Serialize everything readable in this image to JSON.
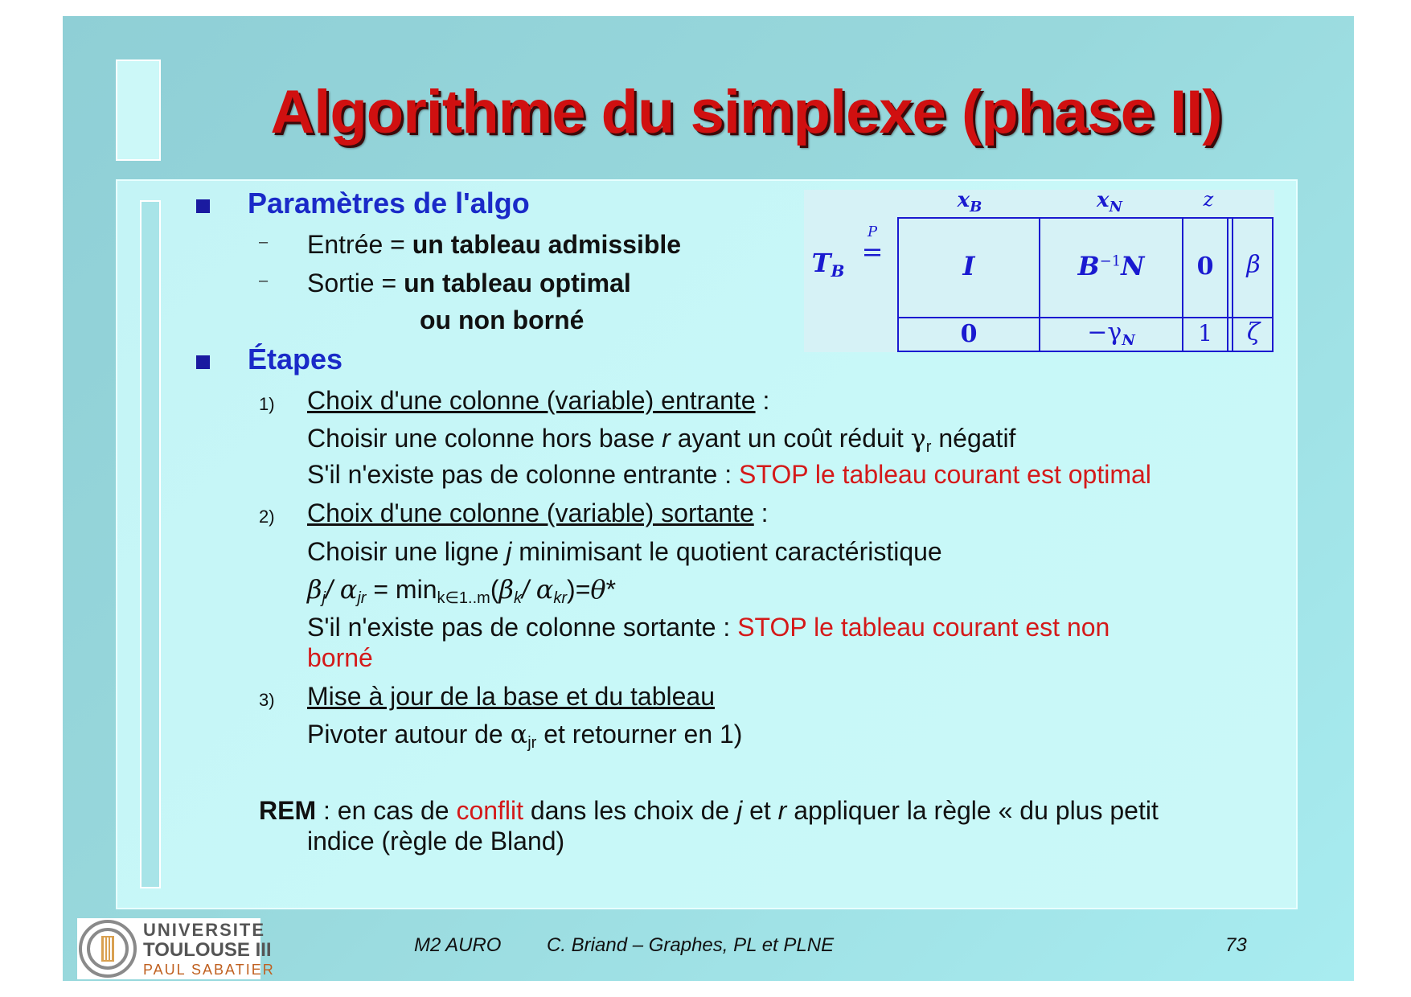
{
  "slide": {
    "title": "Algorithme du simplexe (phase II)",
    "sections": {
      "params_heading": "Paramètres de l'algo",
      "params": [
        {
          "bullet": "–",
          "prefix": "Entrée = ",
          "bold": "un tableau admissible"
        },
        {
          "bullet": "–",
          "prefix": "Sortie = ",
          "bold": "un tableau optimal",
          "bold_line2": "ou non borné"
        }
      ],
      "steps_heading": "Étapes",
      "steps": [
        {
          "num": "1)",
          "title": "Choix d'une colonne (variable) entrante",
          "colon": " :",
          "line1_a": "Choisir une colonne hors base ",
          "line1_var": "r",
          "line1_b": "  ayant un coût réduit ",
          "line1_gamma": "γ",
          "line1_sub": "r",
          "line1_c": " négatif",
          "line2_a": "S'il n'existe pas de colonne entrante : ",
          "line2_red": "STOP le tableau courant est optimal"
        },
        {
          "num": "2)",
          "title": "Choix d'une colonne (variable) sortante",
          "colon": " :",
          "line1_a": "Choisir une ligne ",
          "line1_var": "j",
          "line1_b": " minimisant le quotient caractéristique",
          "formula": {
            "beta": "β",
            "sub_j": "j",
            "slash": "/  ",
            "alpha": "α",
            "sub_jr": "jr",
            "eq_min": " = min",
            "sub_k": "k∈1..m",
            "open": "(",
            "beta_k": "β",
            "sub_k2": "k",
            "slash2": "/  ",
            "alpha_k": "α",
            "sub_kr": "kr",
            "close": ")=",
            "theta": "θ",
            "star": "*"
          },
          "line3_a": "S'il n'existe pas de colonne sortante : ",
          "line3_red": "STOP le tableau courant est non",
          "line3_red2": "borné"
        },
        {
          "num": "3)",
          "title": "Mise à jour de la base et du tableau",
          "line1_a": "Pivoter autour de ",
          "line1_alpha": "α",
          "line1_sub": "jr",
          "line1_b": " et retourner en 1)"
        }
      ],
      "rem": {
        "label": "REM",
        "a": " : en cas de ",
        "red": "conflit",
        "b": " dans les choix de ",
        "j": "j",
        "c": " et ",
        "r": "r",
        "d": " appliquer la règle « du plus petit",
        "line2": "indice (règle de Bland)"
      }
    },
    "tableau": {
      "label_T": "T",
      "label_B": "B",
      "eq_top": "P",
      "eq": "=",
      "col_xB": "x",
      "col_xB_sub": "B",
      "col_xN": "x",
      "col_xN_sub": "N",
      "col_z": "z",
      "cells": {
        "I": "I",
        "BinvN": "B",
        "BinvN_sup": "−1",
        "BinvN_N": "N",
        "zero_top": "0",
        "beta": "β",
        "zero_bottom": "0",
        "minus_gamma": "−γ",
        "minus_gamma_sub": "N",
        "one": "1",
        "zeta": "ζ"
      }
    },
    "footer": {
      "course": "M2 AURO",
      "author": "C. Briand – Graphes, PL et PLNE",
      "page": "73"
    },
    "logo": {
      "line1": "UNIVERSITE",
      "line2": "TOULOUSE III",
      "line3": "PAUL SABATIER"
    },
    "colors": {
      "title": "#d01010",
      "heading": "#1a2ac8",
      "stop_red": "#d41a1a",
      "tableau_blue": "#1a1ad0",
      "background": "#98d8dc"
    }
  }
}
